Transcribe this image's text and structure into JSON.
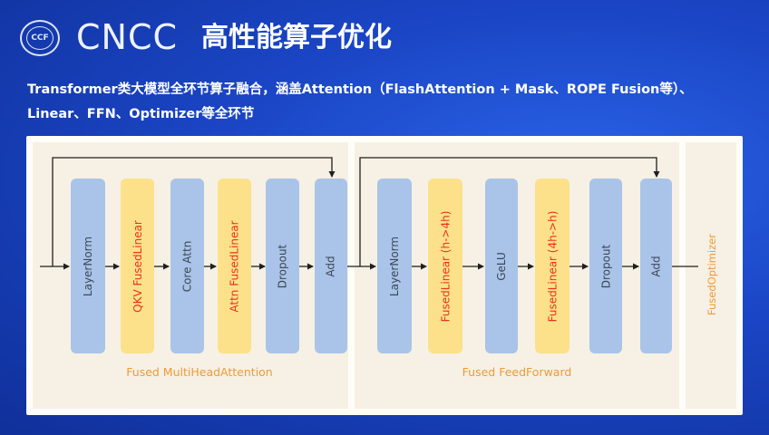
{
  "header": {
    "seal_text": "CCF",
    "brand": "CNCC",
    "title": "高性能算子优化"
  },
  "subtitle": {
    "line1": "Transformer类大模型全环节算子融合，涵盖Attention（FlashAttention + Mask、ROPE Fusion等）、",
    "line2": "Linear、FFN、Optimizer等全环节"
  },
  "diagram": {
    "attention": {
      "label": "Fused MultiHeadAttention",
      "blocks": [
        {
          "label": "LayerNorm",
          "kind": "normal"
        },
        {
          "label": "QKV FusedLinear",
          "kind": "fused"
        },
        {
          "label": "Core Attn",
          "kind": "normal"
        },
        {
          "label": "Attn FusedLinear",
          "kind": "fused"
        },
        {
          "label": "Dropout",
          "kind": "normal"
        },
        {
          "label": "Add",
          "kind": "normal"
        }
      ]
    },
    "feedforward": {
      "label": "Fused FeedForward",
      "blocks": [
        {
          "label": "LayerNorm",
          "kind": "normal"
        },
        {
          "label": "FusedLinear (h->4h)",
          "kind": "fused"
        },
        {
          "label": "GeLU",
          "kind": "normal"
        },
        {
          "label": "FusedLinear (4h->h)",
          "kind": "fused"
        },
        {
          "label": "Dropout",
          "kind": "normal"
        },
        {
          "label": "Add",
          "kind": "normal"
        }
      ]
    },
    "optimizer": {
      "label": "FusedOptimizer"
    },
    "colors": {
      "normal_block": "#a9c4e8",
      "fused_block": "#fde18a",
      "fused_text": "#e8321e",
      "section_label": "#ee9a3a"
    }
  }
}
